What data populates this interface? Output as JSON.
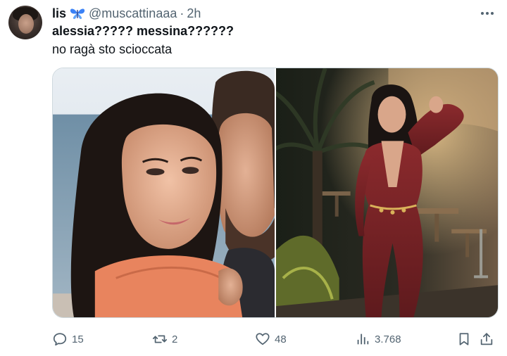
{
  "author": {
    "display_name": "lis",
    "emoji_icon": "butterfly-emoji",
    "handle": "@muscattinaaa",
    "separator": "·",
    "time": "2h"
  },
  "tweet": {
    "line1": "alessia????? messina??????",
    "line2": "no ragà sto scioccata"
  },
  "actions": {
    "reply_count": "15",
    "retweet_count": "2",
    "like_count": "48",
    "views_count": "3.768"
  },
  "icons": [
    "more-icon",
    "reply-icon",
    "retweet-icon",
    "like-icon",
    "views-icon",
    "bookmark-icon",
    "share-icon"
  ],
  "colors": {
    "text_primary": "#0f1419",
    "text_secondary": "#536471",
    "border": "#cfd9de",
    "butterfly": "#3b82f6"
  }
}
